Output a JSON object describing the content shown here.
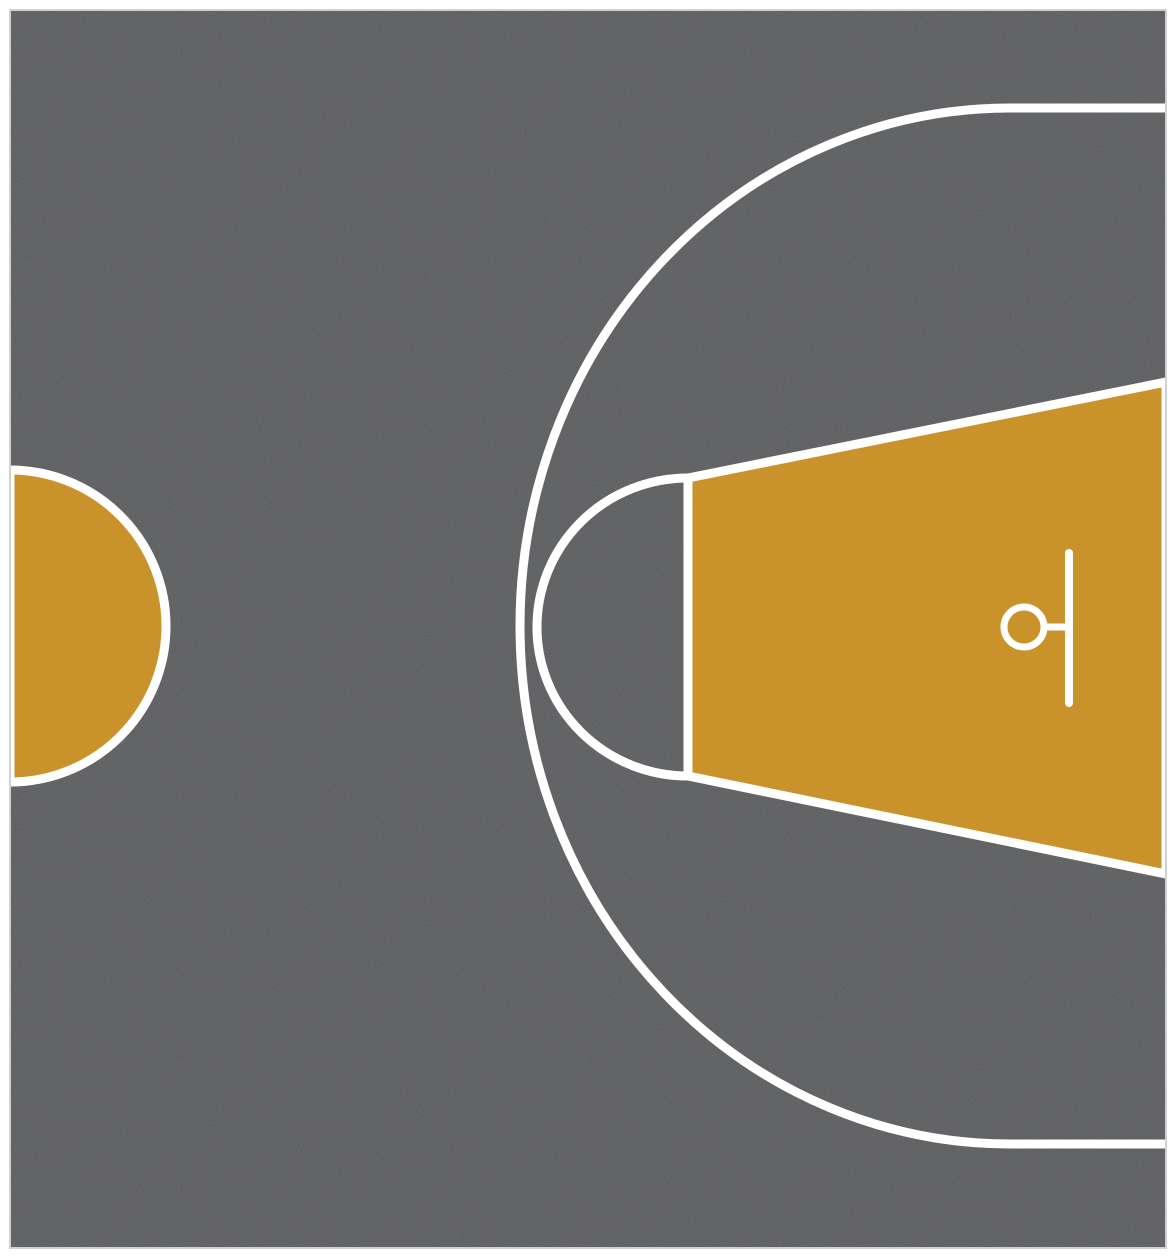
{
  "court": {
    "surface": "asphalt",
    "features": [
      "center-circle",
      "three-point-line",
      "free-throw-circle",
      "key",
      "basket",
      "backboard"
    ],
    "colors": {
      "surface": "#5a5b5d",
      "surface_dark": "#4a4b4d",
      "paint": "#c9922a",
      "lines": "#ffffff",
      "frame": "#ffffff",
      "border": "#cfcfcf"
    }
  }
}
